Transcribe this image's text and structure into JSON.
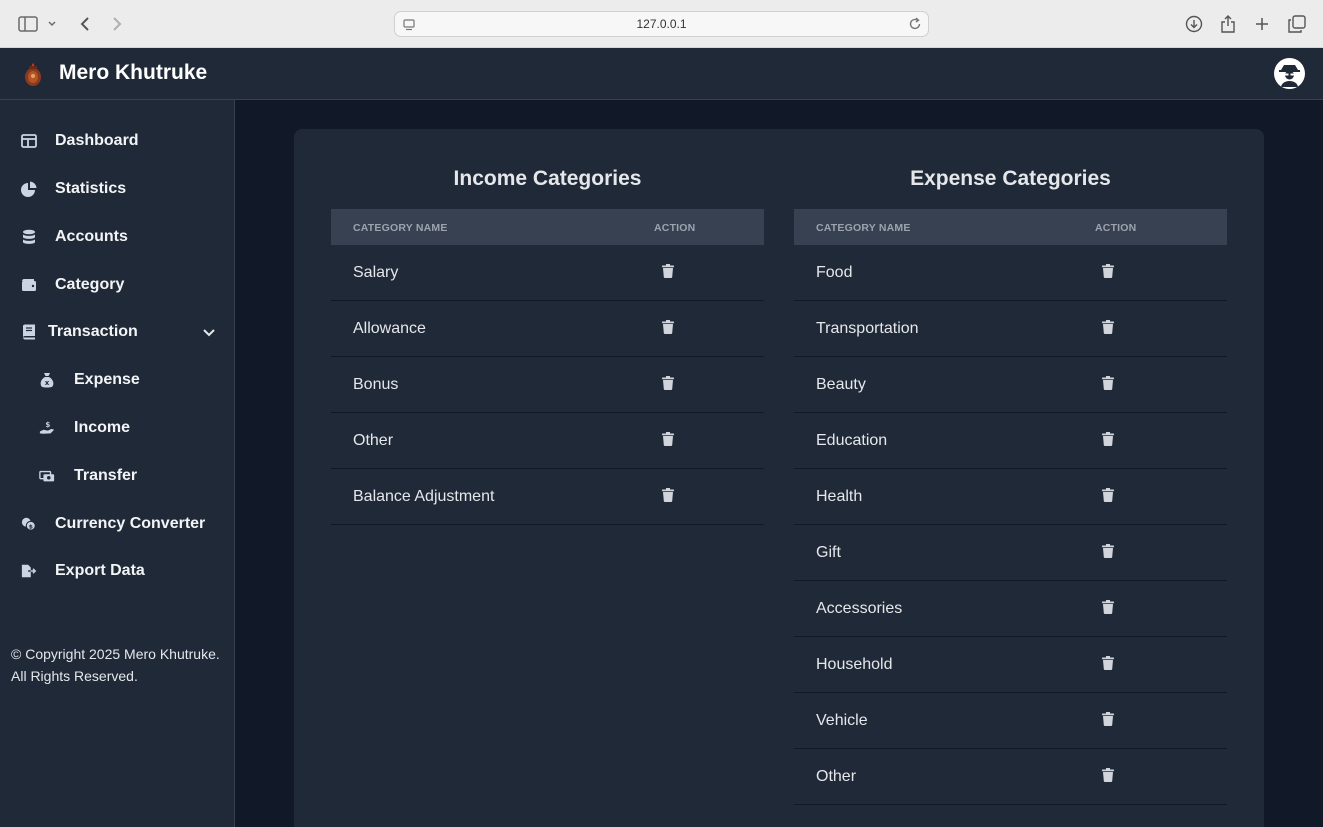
{
  "browser": {
    "url": "127.0.0.1",
    "icons": [
      "sidebar-toggle-icon",
      "chevron-down-icon",
      "back-icon",
      "forward-icon",
      "site-settings-icon",
      "reload-icon",
      "download-icon",
      "share-icon",
      "new-tab-icon",
      "tab-overview-icon"
    ]
  },
  "app": {
    "brand": "Mero Khutruke",
    "colors": {
      "background": "#111827",
      "surface": "#1f2937",
      "header_row": "#374151",
      "text": "#e5e7eb",
      "muted": "#9ca3af"
    }
  },
  "sidebar": {
    "items": [
      {
        "label": "Dashboard",
        "icon": "dashboard-icon"
      },
      {
        "label": "Statistics",
        "icon": "pie-chart-icon"
      },
      {
        "label": "Accounts",
        "icon": "database-icon"
      },
      {
        "label": "Category",
        "icon": "wallet-icon"
      },
      {
        "label": "Transaction",
        "icon": "book-icon",
        "expanded": true
      },
      {
        "label": "Expense",
        "icon": "money-bag-icon"
      },
      {
        "label": "Income",
        "icon": "hand-dollar-icon"
      },
      {
        "label": "Transfer",
        "icon": "money-transfer-icon"
      },
      {
        "label": "Currency Converter",
        "icon": "coins-icon"
      },
      {
        "label": "Export Data",
        "icon": "file-export-icon"
      }
    ],
    "copyright": "© Copyright 2025 Mero Khutruke. All Rights Reserved."
  },
  "income": {
    "title": "Income Categories",
    "col_name": "CATEGORY NAME",
    "col_action": "ACTION",
    "rows": [
      "Salary",
      "Allowance",
      "Bonus",
      "Other",
      "Balance Adjustment"
    ]
  },
  "expense": {
    "title": "Expense Categories",
    "col_name": "CATEGORY NAME",
    "col_action": "ACTION",
    "rows": [
      "Food",
      "Transportation",
      "Beauty",
      "Education",
      "Health",
      "Gift",
      "Accessories",
      "Household",
      "Vehicle",
      "Other"
    ]
  }
}
